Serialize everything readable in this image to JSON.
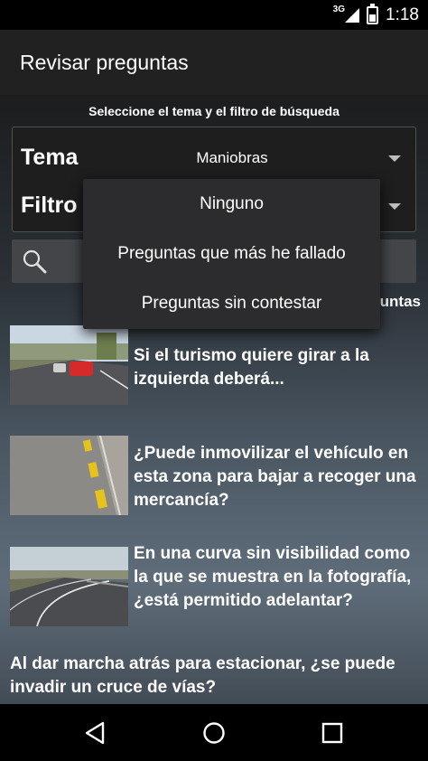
{
  "status_bar": {
    "network": "3G",
    "clock": "1:18",
    "icons": [
      "signal-icon",
      "battery-icon"
    ]
  },
  "app_bar": {
    "title": "Revisar preguntas"
  },
  "filter": {
    "instruction": "Seleccione el tema y el filtro de búsqueda",
    "tema_label": "Tema",
    "tema_value": "Maniobras",
    "filtro_label": "Filtro",
    "filtro_options": [
      "Ninguno",
      "Preguntas que más he fallado",
      "Preguntas sin contestar"
    ]
  },
  "search": {
    "icon": "search-icon"
  },
  "results": {
    "count_partial": "untas"
  },
  "questions": [
    {
      "text": "Si el turismo quiere girar a la izquierda deberá..."
    },
    {
      "text": "¿Puede inmovilizar el vehículo en esta zona para bajar a recoger una mercancía?"
    },
    {
      "text": "En una curva sin visibilidad como la que se muestra en la fotografía, ¿está permitido adelantar?"
    },
    {
      "text": "Al dar marcha atrás para estacionar, ¿se puede invadir un cruce de vías?"
    }
  ],
  "nav_bar": {
    "buttons": [
      "back-icon",
      "home-icon",
      "recents-icon"
    ]
  }
}
